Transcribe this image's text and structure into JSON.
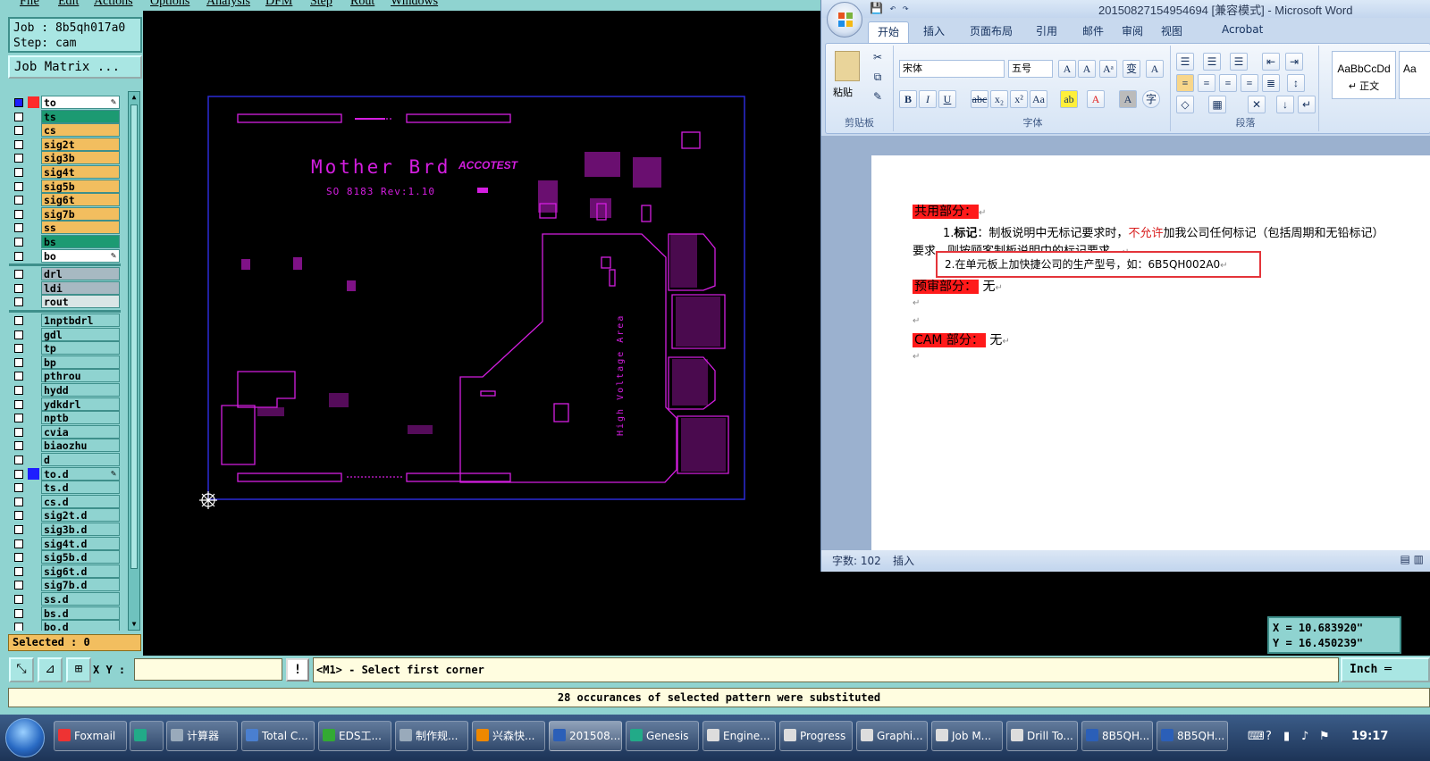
{
  "genesis": {
    "menus": [
      "File",
      "Edit",
      "Actions",
      "Options",
      "Analysis",
      "DFM",
      "Step",
      "Rout",
      "Windows"
    ],
    "job": "Job : 8b5qh017a0",
    "step": "Step: cam",
    "job_matrix_label": "Job Matrix ...",
    "layers_group1": [
      {
        "name": "to",
        "bg": "#ffffff",
        "color": "#ff2a2a",
        "active": true,
        "editable": true
      },
      {
        "name": "ts",
        "bg": "#1c9a72",
        "color": ""
      },
      {
        "name": "cs",
        "bg": "#f2be5f",
        "color": ""
      },
      {
        "name": "sig2t",
        "bg": "#f2be5f",
        "color": ""
      },
      {
        "name": "sig3b",
        "bg": "#f2be5f",
        "color": ""
      },
      {
        "name": "sig4t",
        "bg": "#f2be5f",
        "color": ""
      },
      {
        "name": "sig5b",
        "bg": "#f2be5f",
        "color": ""
      },
      {
        "name": "sig6t",
        "bg": "#f2be5f",
        "color": ""
      },
      {
        "name": "sig7b",
        "bg": "#f2be5f",
        "color": ""
      },
      {
        "name": "ss",
        "bg": "#f2be5f",
        "color": ""
      },
      {
        "name": "bs",
        "bg": "#1c9a72",
        "color": ""
      },
      {
        "name": "bo",
        "bg": "#ffffff",
        "color": "",
        "editable": true
      }
    ],
    "layers_group2": [
      {
        "name": "drl",
        "bg": "#a7b9c2"
      },
      {
        "name": "ldi",
        "bg": "#a7b9c2"
      },
      {
        "name": "rout",
        "bg": "#d9e6e6"
      }
    ],
    "layers_group3": [
      {
        "name": "1nptbdrl"
      },
      {
        "name": "gdl"
      },
      {
        "name": "tp"
      },
      {
        "name": "bp"
      },
      {
        "name": "pthrou"
      },
      {
        "name": "hydd"
      },
      {
        "name": "ydkdrl"
      },
      {
        "name": "nptb"
      },
      {
        "name": "cvia"
      },
      {
        "name": "biaozhu"
      },
      {
        "name": "d"
      },
      {
        "name": "to.d",
        "color": "#1e1eff",
        "editable": true
      },
      {
        "name": "ts.d"
      },
      {
        "name": "cs.d"
      },
      {
        "name": "sig2t.d"
      },
      {
        "name": "sig3b.d"
      },
      {
        "name": "sig4t.d"
      },
      {
        "name": "sig5b.d"
      },
      {
        "name": "sig6t.d"
      },
      {
        "name": "sig7b.d"
      },
      {
        "name": "ss.d"
      },
      {
        "name": "bs.d"
      },
      {
        "name": "bo.d"
      }
    ],
    "selected": "Selected : 0",
    "xy_label": "X Y :",
    "xy_value": "",
    "prompt": "<M1> - Select first corner",
    "units": "Inch",
    "status": "28 occurances of selected pattern were substituted",
    "coord_x": "X = 10.683920\"",
    "coord_y": "Y = 16.450239\"",
    "board": {
      "title": "Mother Brd",
      "logo": "ACCOTEST",
      "subtitle": "SO 8183 Rev:1.10",
      "hv_label": "High Voltage Area"
    },
    "colors": {
      "panel": "#8fd3d0",
      "layer_default": "#8fd3d0",
      "magenta": "#d41ee0",
      "outline": "#2a2ad6"
    }
  },
  "word": {
    "title": "20150827154954694 [兼容模式] - Microsoft Word",
    "tabs": [
      "开始",
      "插入",
      "页面布局",
      "引用",
      "邮件",
      "审阅",
      "视图",
      "Acrobat"
    ],
    "active_tab": "开始",
    "groups": {
      "clipboard": "剪贴板",
      "font": "字体",
      "paragraph": "段落"
    },
    "paste_label": "粘贴",
    "font_name": "宋体",
    "font_size": "五号",
    "style_preview": "AaBbCcDd",
    "style_name": "↵ 正文",
    "style_preview2": "Aa",
    "doc": {
      "heading1": "共用部分：",
      "p1_num": "1.",
      "p1_bold": "标记",
      "p1_a": "：制板说明中无标记要求时，",
      "p1_red": "不允许",
      "p1_b": "加我公司任何标记（包括周期和无铅标记）",
      "p1_line2": "要求，则按顾客制板说明中的标记要求。",
      "callout": "2.在单元板上加快捷公司的生产型号，如：6B5QH002A0",
      "heading2": "预审部分：",
      "heading2_val": "无",
      "heading3": "CAM 部分：",
      "heading3_val": "无"
    },
    "status_words": "字数: 102",
    "status_mode": "插入"
  },
  "taskbar": {
    "items": [
      {
        "label": "Foxmail",
        "color": "#e33"
      },
      {
        "label": "",
        "color": "#2a8"
      },
      {
        "label": "计算器",
        "color": "#9ab"
      },
      {
        "label": "Total C...",
        "color": "#4a7fd0"
      },
      {
        "label": "EDS工...",
        "color": "#3a3"
      },
      {
        "label": "制作规...",
        "color": "#9ab"
      },
      {
        "label": "兴森快...",
        "color": "#e80"
      },
      {
        "label": "201508...",
        "color": "#2b5fb8",
        "active": true
      },
      {
        "label": "Genesis",
        "color": "#2a8"
      },
      {
        "label": "Engine...",
        "color": "#ddd"
      },
      {
        "label": "Progress",
        "color": "#ddd"
      },
      {
        "label": "Graphi...",
        "color": "#ddd"
      },
      {
        "label": "Job M...",
        "color": "#ddd"
      },
      {
        "label": "Drill To...",
        "color": "#ddd"
      },
      {
        "label": "8B5QH...",
        "color": "#2b5fb8"
      },
      {
        "label": "8B5QH...",
        "color": "#2b5fb8"
      }
    ],
    "clock": "19:17"
  }
}
